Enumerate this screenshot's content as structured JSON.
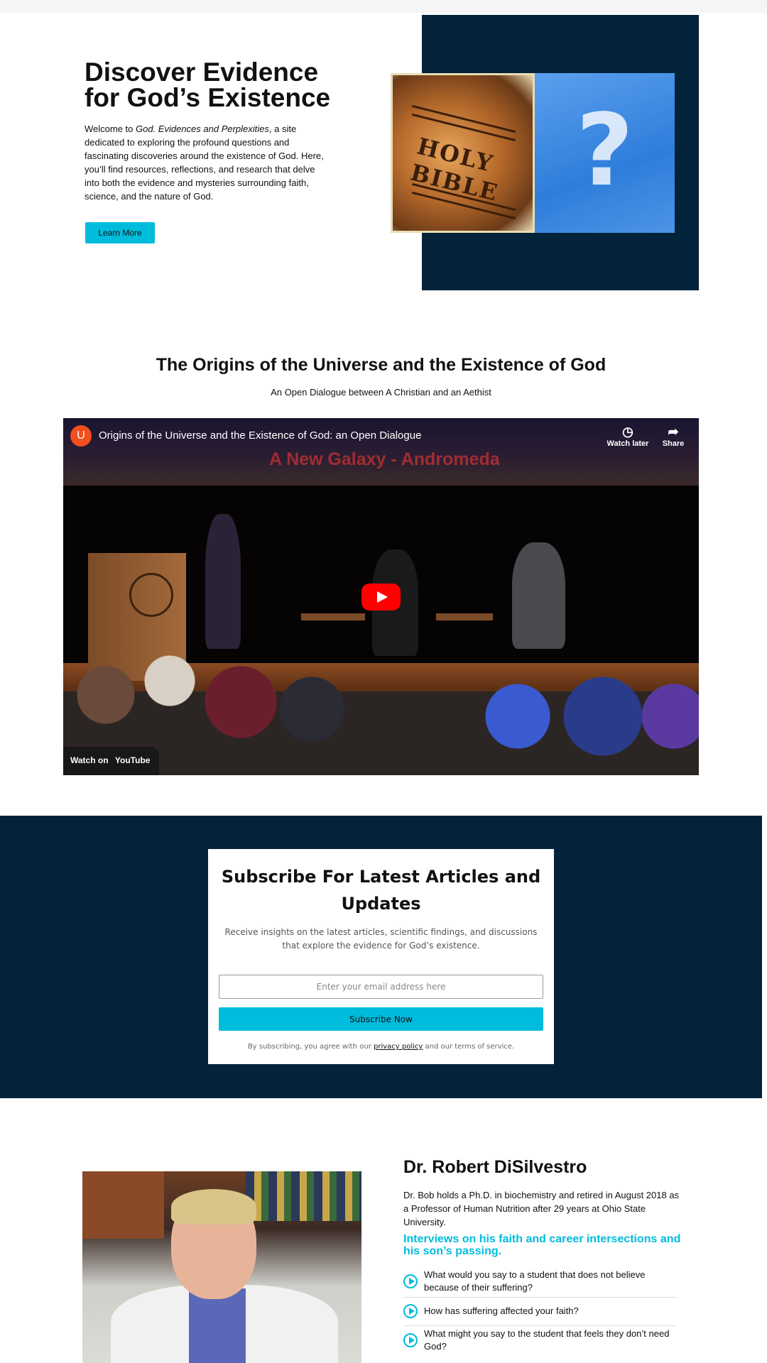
{
  "hero": {
    "title": "Discover Evidence for God’s Existence",
    "intro_prefix": "Welcome to ",
    "intro_site": "God. Evidences and Perplexities",
    "intro_suffix": ", a site dedicated to exploring the profound questions and fascinating discoveries around the existence of God. Here, you’ll find resources, reflections, and research that delve into both the evidence and mysteries surrounding faith, science, and the nature of God.",
    "button_label": "Learn More",
    "image_text": "HOLY BIBLE",
    "image_symbol": "?"
  },
  "origins": {
    "title": "The Origins of the Universe and the Existence of God",
    "subtitle": "An Open Dialogue between A Christian and an Aethist"
  },
  "video": {
    "channel_initial": "U",
    "title": "Origins of the Universe and the Existence of God: an Open Dialogue",
    "banner_text": "A New Galaxy - Andromeda",
    "watch_later": "Watch later",
    "share": "Share",
    "watch_on": "Watch on",
    "youtube": "YouTube"
  },
  "subscribe": {
    "title": "Subscribe For Latest Articles and Updates",
    "text": "Receive insights on the latest articles, scientific findings, and discussions that explore the evidence for God’s existence.",
    "email_placeholder": "Enter your email address here",
    "button_label": "Subscribe Now",
    "legal_prefix": "By subscribing, you agree with our ",
    "legal_link": "privacy policy",
    "legal_suffix": " and our terms of service."
  },
  "bio": {
    "name": "Dr. Robert DiSilvestro",
    "text": "Dr. Bob holds a Ph.D. in biochemistry and retired in August 2018 as a Professor of Human Nutrition after 29 years at Ohio State University.",
    "subtitle": "Interviews on his faith and career intersections and his son’s passing.",
    "questions": [
      "What would you say to a student that does not believe because of their suffering?",
      "How has suffering affected your faith?",
      "What might you say to the student that feels they don’t need God?"
    ]
  },
  "colors": {
    "navy": "#02233a",
    "accent": "#00bcdc",
    "play_red": "#ff0000"
  }
}
